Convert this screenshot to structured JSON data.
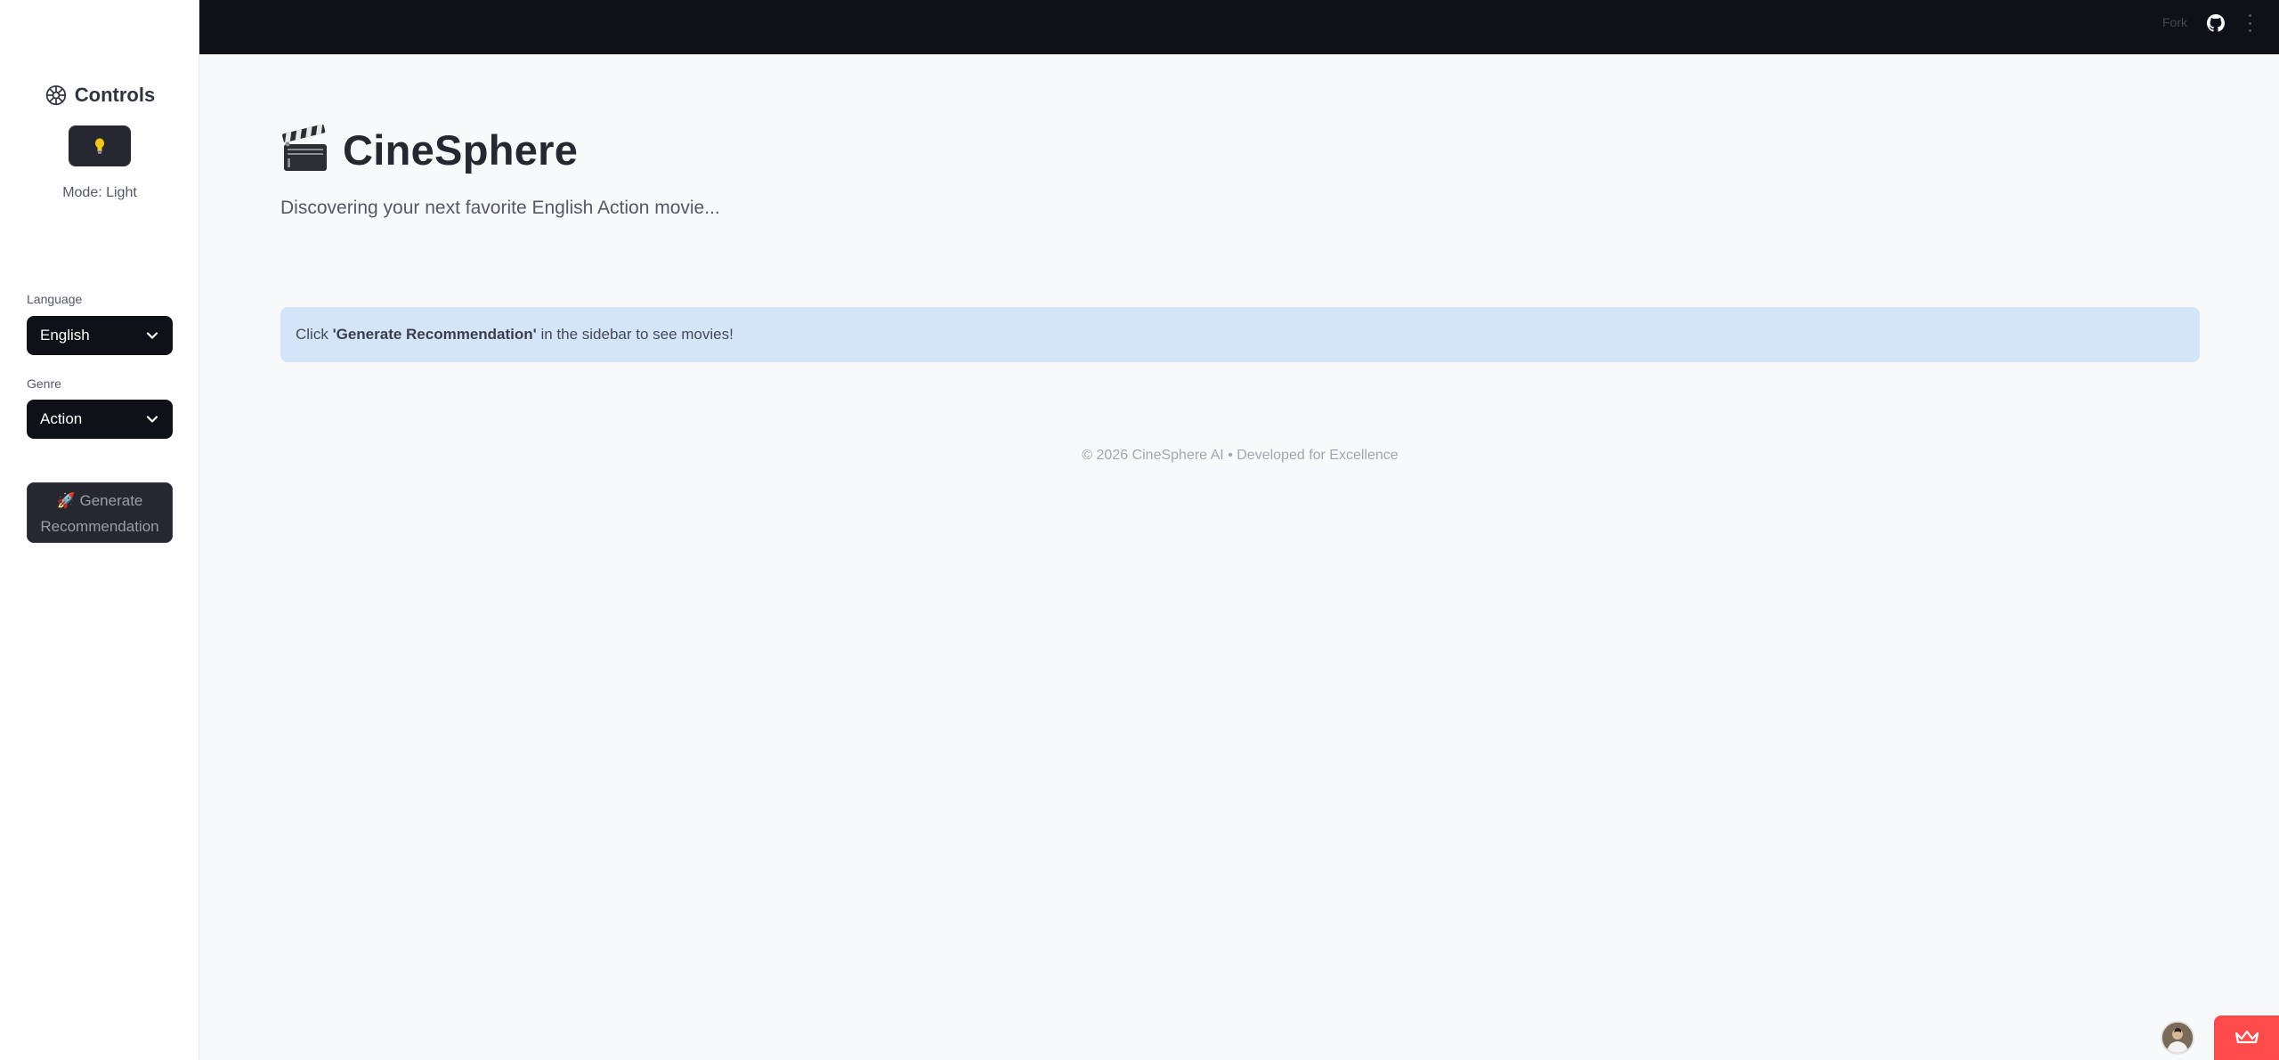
{
  "sidebar": {
    "controls_title": "Controls",
    "mode_label": "Mode: Light",
    "language_label": "Language",
    "language_value": "English",
    "genre_label": "Genre",
    "genre_value": "Action",
    "generate_line1": "🚀 Generate",
    "generate_line2": "Recommendation"
  },
  "header": {
    "fork_label": "Fork"
  },
  "main": {
    "title": "CineSphere",
    "subtitle": "Discovering your next favorite English Action movie...",
    "info_prefix": "Click ",
    "info_bold": "'Generate Recommendation'",
    "info_suffix": " in the sidebar to see movies!",
    "footer": "© 2026 CineSphere AI • Developed for Excellence"
  },
  "colors": {
    "sidebar_bg": "#ffffff",
    "topbar_bg": "#0e1117",
    "main_bg": "#f8f9fb",
    "info_bg": "#d4e5f9",
    "select_bg": "#0e1117",
    "button_bg": "#262730",
    "accent_red": "#ff4b4b"
  },
  "icons": {
    "controls": "gear-icon",
    "theme": "lightbulb-icon",
    "select": "chevron-down-icon",
    "title": "clapperboard-icon",
    "header": "github-icon",
    "menu": "kebab-menu-icon",
    "corner": "crown-icon"
  }
}
